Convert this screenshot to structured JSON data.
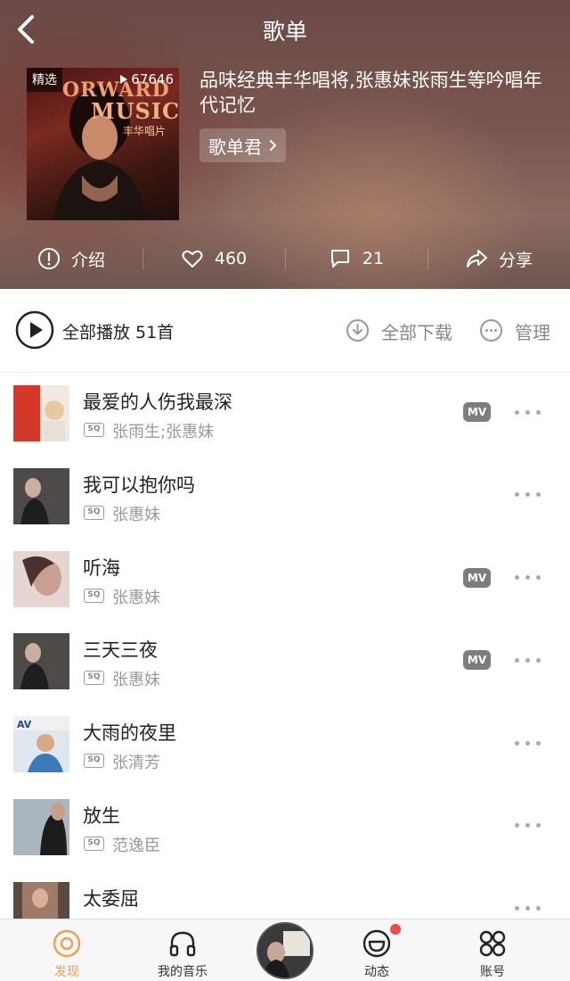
{
  "nav": {
    "title": "歌单"
  },
  "playlist": {
    "badge": "精选",
    "play_count": "67646",
    "cover_line_1": "ORWARD",
    "cover_line_2": "MUSIC",
    "cover_line_3": "丰华唱片",
    "description": "品味经典丰华唱将,张惠妹张雨生等吟唱年代记忆",
    "creator": "歌单君"
  },
  "actions": {
    "intro": "介绍",
    "likes": "460",
    "comments": "21",
    "share": "分享"
  },
  "play_bar": {
    "play_all": "全部播放 51首",
    "download_all": "全部下载",
    "manage": "管理"
  },
  "songs": [
    {
      "title": "最爱的人伤我最深",
      "artist": "张雨生;张惠妹",
      "quality": "SQ",
      "mv": "MV"
    },
    {
      "title": "我可以抱你吗",
      "artist": "张惠妹",
      "quality": "SQ",
      "mv": ""
    },
    {
      "title": "听海",
      "artist": "张惠妹",
      "quality": "SQ",
      "mv": "MV"
    },
    {
      "title": "三天三夜",
      "artist": "张惠妹",
      "quality": "SQ",
      "mv": "MV"
    },
    {
      "title": "大雨的夜里",
      "artist": "张清芳",
      "quality": "SQ",
      "mv": ""
    },
    {
      "title": "放生",
      "artist": "范逸臣",
      "quality": "SQ",
      "mv": ""
    },
    {
      "title": "太委屈",
      "artist": "",
      "quality": "",
      "mv": ""
    }
  ],
  "tabs": [
    {
      "label": "发现",
      "icon": "discover-icon",
      "active": true
    },
    {
      "label": "我的音乐",
      "icon": "headphones-icon",
      "active": false
    },
    {
      "label": "",
      "icon": "now-playing-disc",
      "active": false
    },
    {
      "label": "动态",
      "icon": "activity-icon",
      "active": false
    },
    {
      "label": "账号",
      "icon": "account-grid-icon",
      "active": false
    }
  ],
  "colors": {
    "accent": "#f0a050",
    "header_bg": "#7a5650",
    "badge_gray": "#7d7d7d",
    "notify_red": "#f04a4a"
  }
}
